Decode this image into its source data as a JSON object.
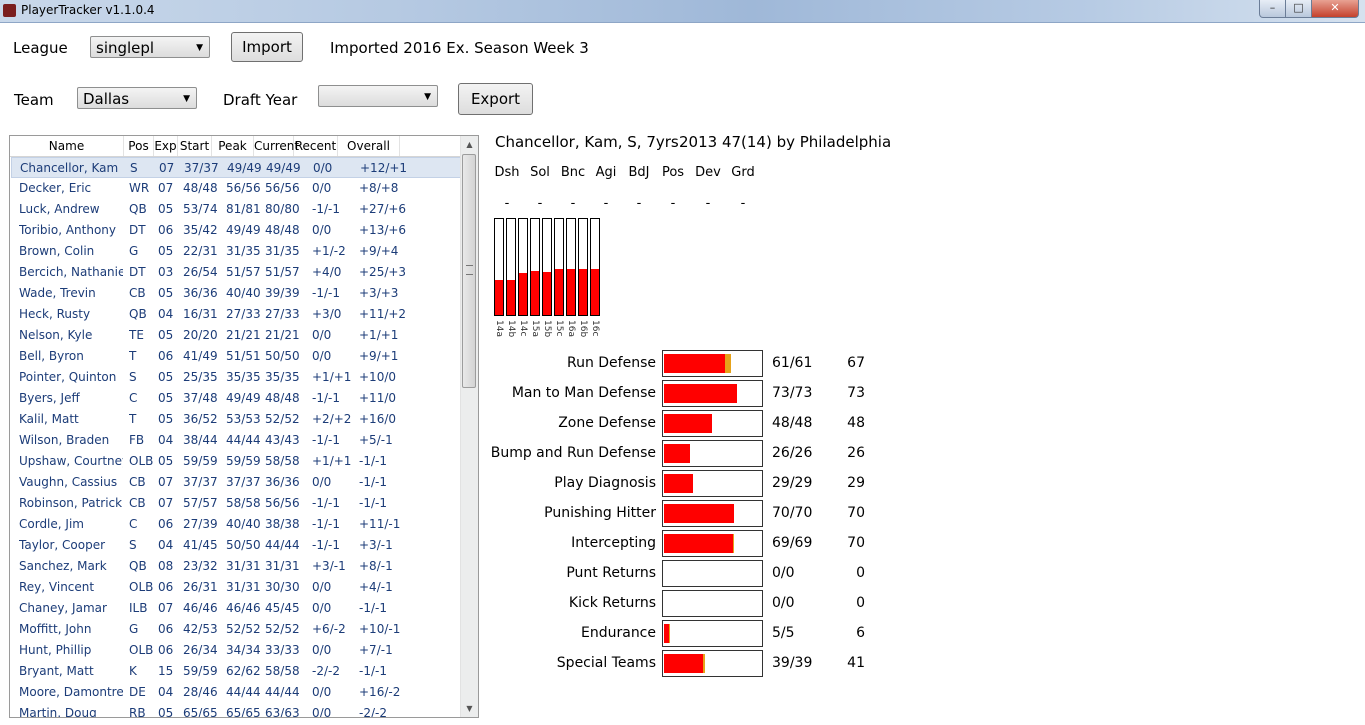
{
  "window": {
    "title": "PlayerTracker v1.1.0.4",
    "minimize": "–",
    "maximize": "□",
    "close": "✕"
  },
  "toolbar": {
    "league_label": "League",
    "league_value": "singlepl",
    "import_label": "Import",
    "status_text": "Imported 2016 Ex. Season Week 3",
    "team_label": "Team",
    "team_value": "Dallas",
    "draft_year_label": "Draft Year",
    "draft_year_value": "",
    "export_label": "Export"
  },
  "list": {
    "headers": [
      "Name",
      "Pos",
      "Exp",
      "Start",
      "Peak",
      "Current",
      "Recent",
      "Overall"
    ],
    "rows": [
      [
        "Chancellor, Kam",
        "S",
        "07",
        "37/37",
        "49/49",
        "49/49",
        "0/0",
        "+12/+1"
      ],
      [
        "Decker, Eric",
        "WR",
        "07",
        "48/48",
        "56/56",
        "56/56",
        "0/0",
        "+8/+8"
      ],
      [
        "Luck, Andrew",
        "QB",
        "05",
        "53/74",
        "81/81",
        "80/80",
        "-1/-1",
        "+27/+6"
      ],
      [
        "Toribio, Anthony",
        "DT",
        "06",
        "35/42",
        "49/49",
        "48/48",
        "0/0",
        "+13/+6"
      ],
      [
        "Brown, Colin",
        "G",
        "05",
        "22/31",
        "31/35",
        "31/35",
        "+1/-2",
        "+9/+4"
      ],
      [
        "Bercich, Nathaniel",
        "DT",
        "03",
        "26/54",
        "51/57",
        "51/57",
        "+4/0",
        "+25/+3"
      ],
      [
        "Wade, Trevin",
        "CB",
        "05",
        "36/36",
        "40/40",
        "39/39",
        "-1/-1",
        "+3/+3"
      ],
      [
        "Heck, Rusty",
        "QB",
        "04",
        "16/31",
        "27/33",
        "27/33",
        "+3/0",
        "+11/+2"
      ],
      [
        "Nelson, Kyle",
        "TE",
        "05",
        "20/20",
        "21/21",
        "21/21",
        "0/0",
        "+1/+1"
      ],
      [
        "Bell, Byron",
        "T",
        "06",
        "41/49",
        "51/51",
        "50/50",
        "0/0",
        "+9/+1"
      ],
      [
        "Pointer, Quinton",
        "S",
        "05",
        "25/35",
        "35/35",
        "35/35",
        "+1/+1",
        "+10/0"
      ],
      [
        "Byers, Jeff",
        "C",
        "05",
        "37/48",
        "49/49",
        "48/48",
        "-1/-1",
        "+11/0"
      ],
      [
        "Kalil, Matt",
        "T",
        "05",
        "36/52",
        "53/53",
        "52/52",
        "+2/+2",
        "+16/0"
      ],
      [
        "Wilson, Braden",
        "FB",
        "04",
        "38/44",
        "44/44",
        "43/43",
        "-1/-1",
        "+5/-1"
      ],
      [
        "Upshaw, Courtney",
        "OLB",
        "05",
        "59/59",
        "59/59",
        "58/58",
        "+1/+1",
        "-1/-1"
      ],
      [
        "Vaughn, Cassius",
        "CB",
        "07",
        "37/37",
        "37/37",
        "36/36",
        "0/0",
        "-1/-1"
      ],
      [
        "Robinson, Patrick",
        "CB",
        "07",
        "57/57",
        "58/58",
        "56/56",
        "-1/-1",
        "-1/-1"
      ],
      [
        "Cordle, Jim",
        "C",
        "06",
        "27/39",
        "40/40",
        "38/38",
        "-1/-1",
        "+11/-1"
      ],
      [
        "Taylor, Cooper",
        "S",
        "04",
        "41/45",
        "50/50",
        "44/44",
        "-1/-1",
        "+3/-1"
      ],
      [
        "Sanchez, Mark",
        "QB",
        "08",
        "23/32",
        "31/31",
        "31/31",
        "+3/-1",
        "+8/-1"
      ],
      [
        "Rey, Vincent",
        "OLB",
        "06",
        "26/31",
        "31/31",
        "30/30",
        "0/0",
        "+4/-1"
      ],
      [
        "Chaney, Jamar",
        "ILB",
        "07",
        "46/46",
        "46/46",
        "45/45",
        "0/0",
        "-1/-1"
      ],
      [
        "Moffitt, John",
        "G",
        "06",
        "42/53",
        "52/52",
        "52/52",
        "+6/-2",
        "+10/-1"
      ],
      [
        "Hunt, Phillip",
        "OLB",
        "06",
        "26/34",
        "34/34",
        "33/33",
        "0/0",
        "+7/-1"
      ],
      [
        "Bryant, Matt",
        "K",
        "15",
        "59/59",
        "62/62",
        "58/58",
        "-2/-2",
        "-1/-1"
      ],
      [
        "Moore, Damontre",
        "DE",
        "04",
        "28/46",
        "44/44",
        "44/44",
        "0/0",
        "+16/-2"
      ],
      [
        "Martin, Doug",
        "RB",
        "05",
        "65/65",
        "65/65",
        "63/63",
        "0/0",
        "-2/-2"
      ]
    ]
  },
  "player": {
    "header": "Chancellor, Kam, S, 7yrs",
    "draft": "2013 47(14) by Philadelphia",
    "skills": [
      {
        "label": "Dsh",
        "value": "-"
      },
      {
        "label": "Sol",
        "value": "-"
      },
      {
        "label": "Bnc",
        "value": "-"
      },
      {
        "label": "Agi",
        "value": "-"
      },
      {
        "label": "BdJ",
        "value": "-"
      },
      {
        "label": "Pos",
        "value": "-"
      },
      {
        "label": "Dev",
        "value": "-"
      },
      {
        "label": "Grd",
        "value": "-"
      }
    ],
    "trend": {
      "labels": [
        "14a",
        "14b",
        "14c",
        "15a",
        "15b",
        "15c",
        "16a",
        "16b",
        "16c"
      ],
      "values": [
        0.36,
        0.36,
        0.44,
        0.46,
        0.45,
        0.48,
        0.48,
        0.48,
        0.48
      ]
    },
    "attributes": [
      {
        "name": "Run Defense",
        "value": "61/61",
        "overall": "67",
        "cur": 61,
        "ovr": 67
      },
      {
        "name": "Man to Man Defense",
        "value": "73/73",
        "overall": "73",
        "cur": 73,
        "ovr": 73
      },
      {
        "name": "Zone Defense",
        "value": "48/48",
        "overall": "48",
        "cur": 48,
        "ovr": 48
      },
      {
        "name": "Bump and Run Defense",
        "value": "26/26",
        "overall": "26",
        "cur": 26,
        "ovr": 26
      },
      {
        "name": "Play Diagnosis",
        "value": "29/29",
        "overall": "29",
        "cur": 29,
        "ovr": 29
      },
      {
        "name": "Punishing Hitter",
        "value": "70/70",
        "overall": "70",
        "cur": 70,
        "ovr": 70
      },
      {
        "name": "Intercepting",
        "value": "69/69",
        "overall": "70",
        "cur": 69,
        "ovr": 70
      },
      {
        "name": "Punt Returns",
        "value": "0/0",
        "overall": "0",
        "cur": 0,
        "ovr": 0
      },
      {
        "name": "Kick Returns",
        "value": "0/0",
        "overall": "0",
        "cur": 0,
        "ovr": 0
      },
      {
        "name": "Endurance",
        "value": "5/5",
        "overall": "6",
        "cur": 5,
        "ovr": 6
      },
      {
        "name": "Special Teams",
        "value": "39/39",
        "overall": "41",
        "cur": 39,
        "ovr": 41
      }
    ]
  },
  "colors": {
    "bar_fill": "#ff0000",
    "bar_extra": "#e6a21a",
    "row_text": "#1c3c78",
    "selected_row": "#dde6f2"
  }
}
